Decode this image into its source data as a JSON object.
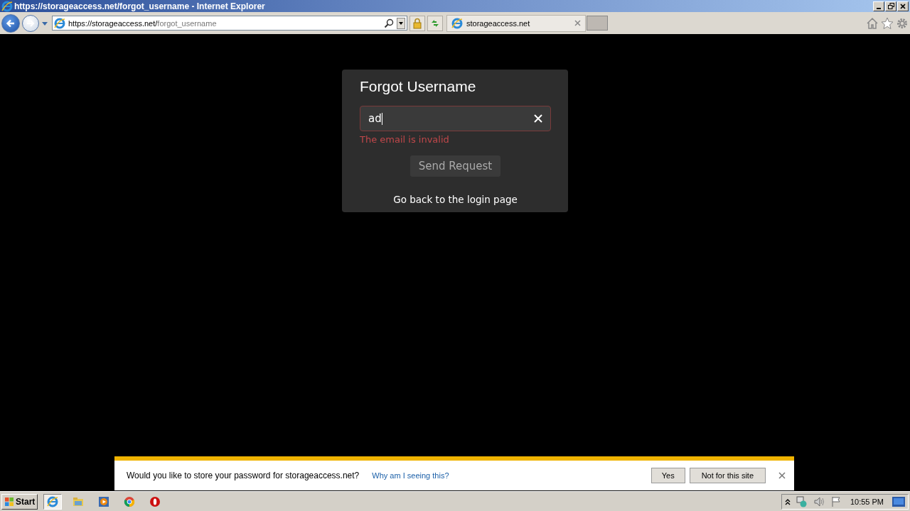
{
  "window": {
    "title": "https://storageaccess.net/forgot_username - Internet Explorer"
  },
  "address_bar": {
    "host": "https://storageaccess.net/",
    "path": "forgot_username"
  },
  "tabs": [
    {
      "label": "storageaccess.net",
      "selected": true
    }
  ],
  "page": {
    "title": "Forgot Username",
    "email_field": {
      "value": "ad",
      "invalid": true
    },
    "error": "The email is invalid",
    "button": "Send Request",
    "link": "Go back to the login page"
  },
  "notification": {
    "message": "Would you like to store your password for storageaccess.net?",
    "link": "Why am I seeing this?",
    "buttons": [
      "Yes",
      "Not for this site"
    ]
  },
  "taskbar": {
    "start": "Start",
    "apps": [
      {
        "kind": "ie",
        "selected": true
      },
      {
        "kind": "folder",
        "selected": false
      },
      {
        "kind": "media",
        "selected": false
      },
      {
        "kind": "chrome",
        "selected": false
      },
      {
        "kind": "opera",
        "selected": false
      }
    ],
    "clock": "10:55 PM"
  }
}
